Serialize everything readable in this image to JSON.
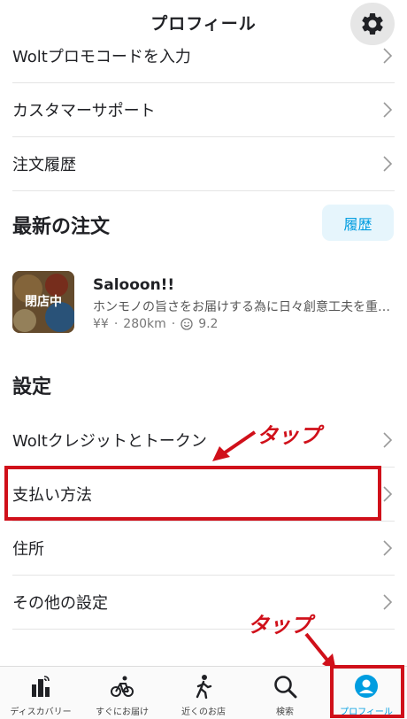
{
  "header": {
    "title": "プロフィール"
  },
  "account_rows": [
    {
      "label": "Woltプロモコードを入力"
    },
    {
      "label": "カスタマーサポート"
    },
    {
      "label": "注文履歴"
    }
  ],
  "recent_orders": {
    "title": "最新の注文",
    "history_button": "履歴",
    "order": {
      "name": "Salooon!!",
      "badge": "閉店中",
      "description": "ホンモノの旨さをお届けする為に日々創意工夫を重…",
      "price_level": "¥¥",
      "distance": "280km",
      "rating": "9.2"
    }
  },
  "settings": {
    "title": "設定",
    "rows": [
      {
        "label": "Woltクレジットとトークン"
      },
      {
        "label": "支払い方法"
      },
      {
        "label": "住所"
      },
      {
        "label": "その他の設定"
      }
    ]
  },
  "annotations": {
    "tap1": "タップ",
    "tap2": "タップ"
  },
  "tabbar": {
    "tabs": [
      {
        "label": "ディスカバリー",
        "icon": "discovery-icon"
      },
      {
        "label": "すぐにお届け",
        "icon": "bike-icon"
      },
      {
        "label": "近くのお店",
        "icon": "walking-icon"
      },
      {
        "label": "検索",
        "icon": "search-icon"
      },
      {
        "label": "プロフィール",
        "icon": "profile-icon",
        "active": true
      }
    ]
  },
  "colors": {
    "accent": "#009de0",
    "annotation": "#d0101a"
  }
}
